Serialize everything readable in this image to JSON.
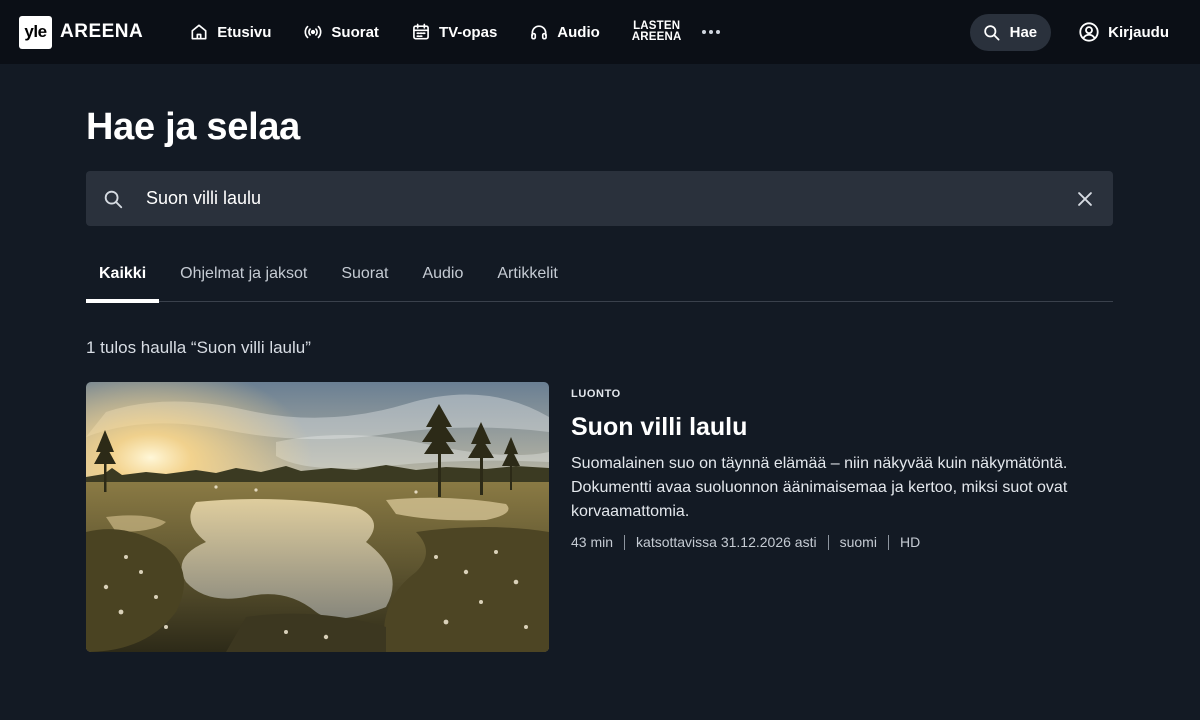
{
  "brand": {
    "badge": "yle",
    "name": "AREENA"
  },
  "nav": {
    "items": [
      {
        "label": "Etusivu",
        "icon": "home-icon"
      },
      {
        "label": "Suorat",
        "icon": "broadcast-icon"
      },
      {
        "label": "TV-opas",
        "icon": "calendar-icon"
      },
      {
        "label": "Audio",
        "icon": "headphones-icon"
      }
    ],
    "lasten_line1": "LASTEN",
    "lasten_line2": "AREENA",
    "more_icon": "more-icon"
  },
  "header": {
    "search_label": "Hae",
    "login_label": "Kirjaudu"
  },
  "main": {
    "title": "Hae ja selaa",
    "search_value": "Suon villi laulu",
    "tabs": [
      {
        "label": "Kaikki",
        "active": true
      },
      {
        "label": "Ohjelmat ja jaksot",
        "active": false
      },
      {
        "label": "Suorat",
        "active": false
      },
      {
        "label": "Audio",
        "active": false
      },
      {
        "label": "Artikkelit",
        "active": false
      }
    ],
    "result_count": "1 tulos haulla “Suon villi laulu”"
  },
  "result": {
    "category": "LUONTO",
    "title": "Suon villi laulu",
    "description": "Suomalainen suo on täynnä elämää – niin näkyvää kuin näkymätöntä. Dokumentti avaa suoluonnon äänimaisemaa ja kertoo, miksi suot ovat korvaamattomia.",
    "duration": "43 min",
    "availability": "katsottavissa 31.12.2026 asti",
    "language": "suomi",
    "quality": "HD"
  },
  "colors": {
    "background": "#131a24",
    "topbar": "#0b0f16",
    "field": "#2a313c",
    "text": "#ffffff"
  }
}
